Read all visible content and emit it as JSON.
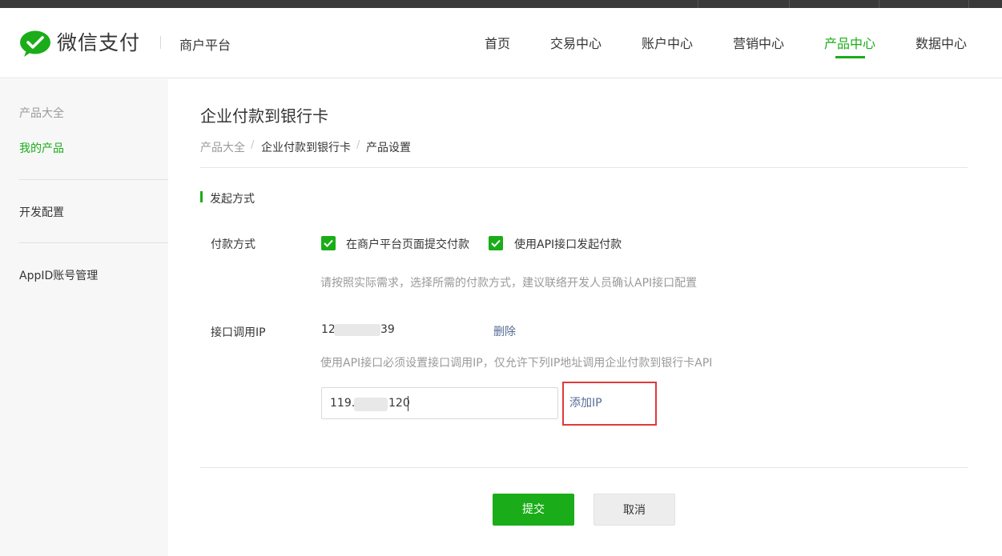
{
  "brand": {
    "logo_text": "微信支付",
    "platform": "商户平台",
    "accent": "#1aad19"
  },
  "nav": {
    "items": [
      {
        "label": "首页"
      },
      {
        "label": "交易中心"
      },
      {
        "label": "账户中心"
      },
      {
        "label": "营销中心"
      },
      {
        "label": "产品中心",
        "active": true
      },
      {
        "label": "数据中心"
      }
    ]
  },
  "sidebar": {
    "items": [
      {
        "label": "产品大全"
      },
      {
        "label": "我的产品",
        "active": true
      },
      {
        "label": "开发配置"
      },
      {
        "label": "AppID账号管理"
      }
    ]
  },
  "page": {
    "title": "企业付款到银行卡",
    "breadcrumb": [
      "产品大全",
      "企业付款到银行卡",
      "产品设置"
    ],
    "breadcrumb_sep": "/"
  },
  "form": {
    "section_title": "发起方式",
    "payment": {
      "label": "付款方式",
      "options": [
        {
          "label": "在商户平台页面提交付款",
          "checked": true
        },
        {
          "label": "使用API接口发起付款",
          "checked": true
        }
      ],
      "hint": "请按照实际需求，选择所需的付款方式，建议联络开发人员确认API接口配置"
    },
    "ip": {
      "label": "接口调用IP",
      "existing_prefix": "12",
      "existing_suffix": "39",
      "delete_label": "删除",
      "hint": "使用API接口必须设置接口调用IP，仅允许下列IP地址调用企业付款到银行卡API",
      "input_prefix": "119.",
      "input_suffix": "120",
      "add_label": "添加IP"
    }
  },
  "actions": {
    "submit": "提交",
    "cancel": "取消"
  }
}
